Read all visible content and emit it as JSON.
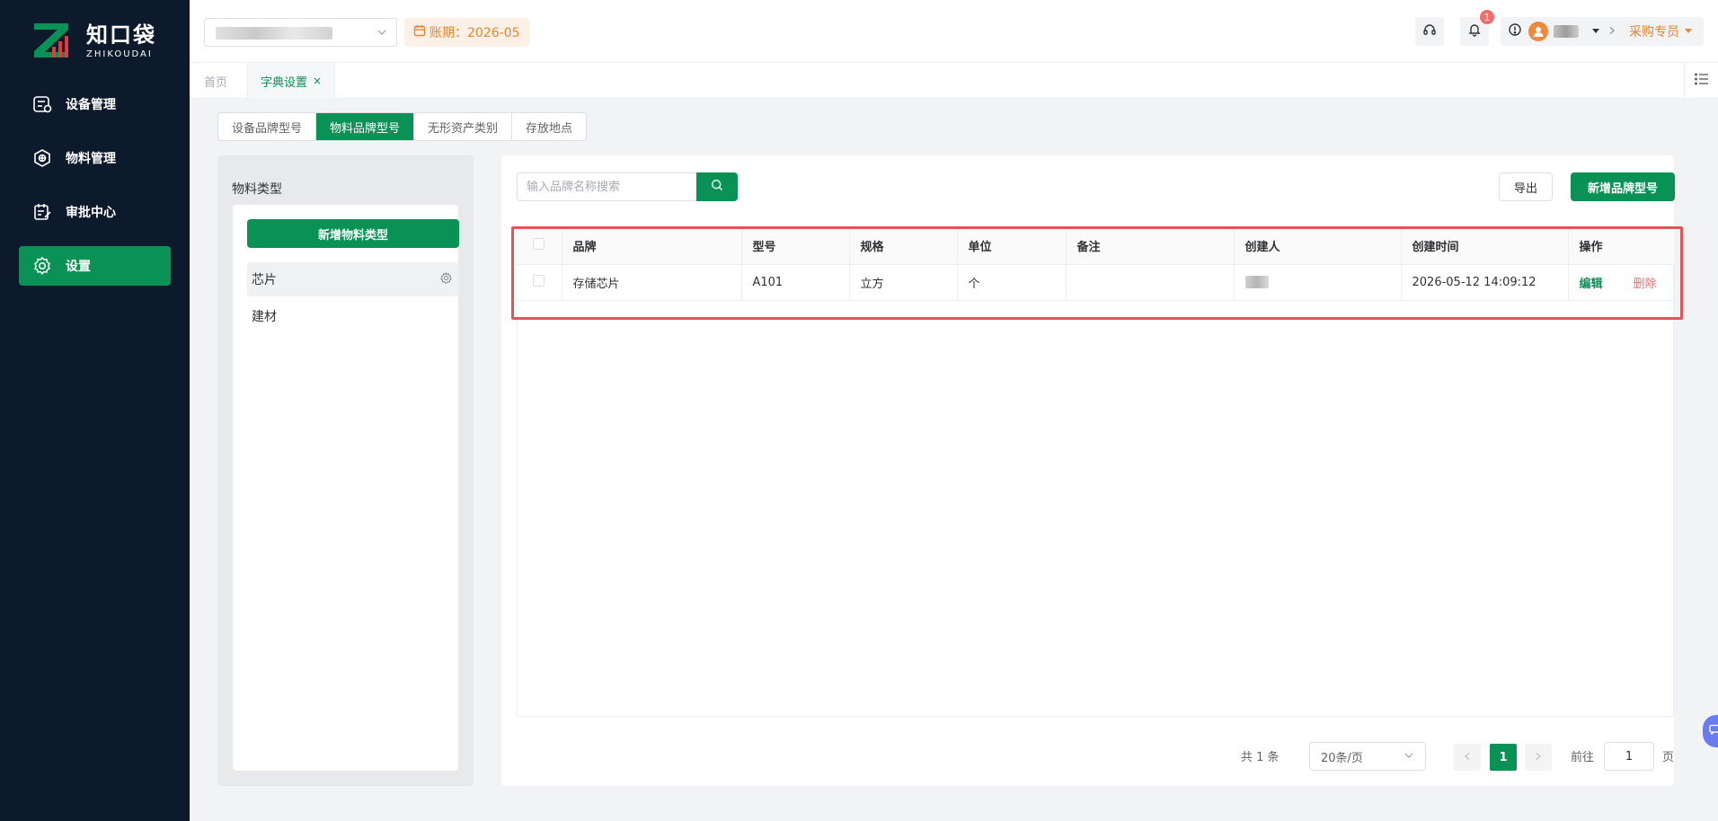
{
  "brand": {
    "name_cn": "知口袋",
    "name_en": "ZHIKOUDAI",
    "accent": "#0a9155"
  },
  "sidebar": {
    "items": [
      {
        "label": "设备管理",
        "icon": "equipment-icon",
        "active": false
      },
      {
        "label": "物料管理",
        "icon": "material-icon",
        "active": false
      },
      {
        "label": "审批中心",
        "icon": "approval-icon",
        "active": false
      },
      {
        "label": "设置",
        "icon": "gear-icon",
        "active": true
      }
    ]
  },
  "header": {
    "period_label": "账期：2026-05",
    "notification_count": "1",
    "role_label": "采购专员"
  },
  "tabs": {
    "home": "首页",
    "current": "字典设置",
    "close": "×"
  },
  "subtabs": [
    "设备品牌型号",
    "物料品牌型号",
    "无形资产类别",
    "存放地点"
  ],
  "left_panel": {
    "title": "物料类型",
    "add_button": "新增物料类型",
    "categories": [
      "芯片",
      "建材"
    ]
  },
  "right_panel": {
    "search_placeholder": "输入品牌名称搜索",
    "export_button": "导出",
    "add_button": "新增品牌型号",
    "table": {
      "headers": [
        "品牌",
        "型号",
        "规格",
        "单位",
        "备注",
        "创建人",
        "创建时间",
        "操作"
      ],
      "rows": [
        {
          "brand": "存储芯片",
          "model": "A101",
          "spec": "立方",
          "unit": "个",
          "remark": "",
          "created_at": "2026-05-12 14:09:12",
          "edit": "编辑",
          "delete": "删除"
        }
      ]
    },
    "pagination": {
      "total": "共 1 条",
      "page_size": "20条/页",
      "current_page": "1",
      "goto_label": "前往",
      "goto_value": "1",
      "page_suffix": "页"
    }
  }
}
